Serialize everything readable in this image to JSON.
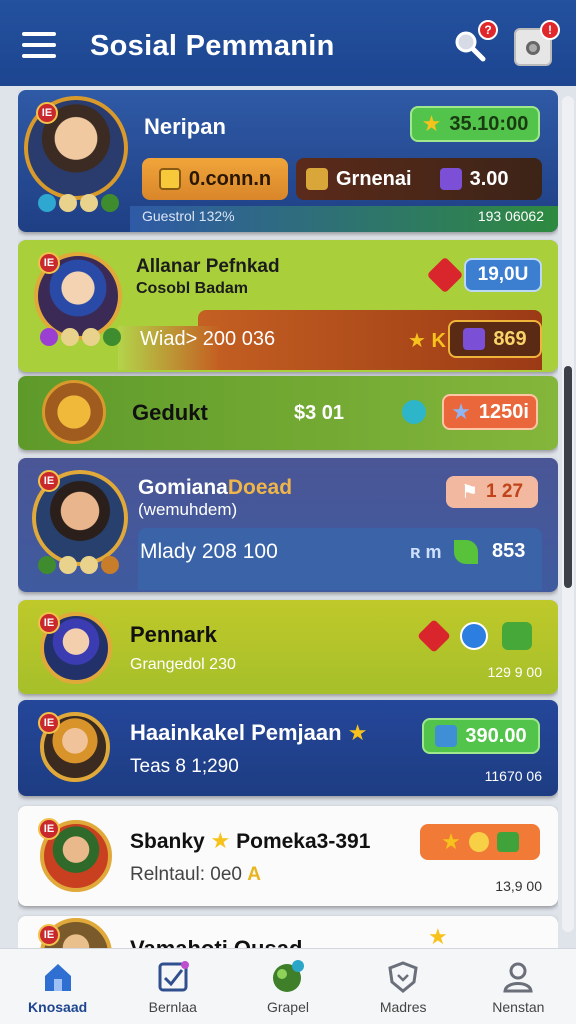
{
  "header": {
    "title": "Sosial Pemmanin",
    "search_badge": "?",
    "notif_badge": "!"
  },
  "cards": [
    {
      "name": "Neripan",
      "rank": "IE",
      "score": "35.10:00",
      "left_pill": "0.conn.n",
      "right_label": "Grnenai",
      "right_value": "3.00",
      "footer_left": "Guestrol 132%",
      "footer_right": "193 06062"
    },
    {
      "name": "Allanar Pefnkad",
      "subname": "Cosobl Badam",
      "rank": "IE",
      "badge_value": "19,0U",
      "bar_label": "Wiad> 200 036",
      "bar_icons": "★ K",
      "bar_value": "869"
    },
    {
      "name": "Gedukt",
      "value": "$3 01",
      "pill_value": "1250i"
    },
    {
      "name_part1": "Gomiana",
      "name_part2": "Doead",
      "subname": "(wemuhdem)",
      "rank": "IE",
      "badge_value": "1 27",
      "bar_label": "Mlady 208 100",
      "bar_icons": "ʀ m",
      "bar_value": "853"
    },
    {
      "name": "Pennark",
      "subname": "Grangedol 230",
      "rank": "IE",
      "footer_right": "129 9 00"
    },
    {
      "name": "Haainkakel Pemjaan",
      "subname": "Teas 8 1;290",
      "rank": "IE",
      "pill_value": "390.00",
      "footer_right": "11670 06"
    },
    {
      "name": "Sbanky",
      "name_suffix": "Pomeka3-391",
      "subname": "Relntaul: 0e0",
      "rank": "IE",
      "footer_right": "13,9 00"
    },
    {
      "name": "Vamahoti Ousad",
      "rank": "IE"
    }
  ],
  "nav": [
    {
      "label": "Knosaad",
      "icon": "home-icon"
    },
    {
      "label": "Bernlaa",
      "icon": "checklist-icon"
    },
    {
      "label": "Grapel",
      "icon": "globe-icon"
    },
    {
      "label": "Madres",
      "icon": "shield-icon"
    },
    {
      "label": "Nenstan",
      "icon": "person-icon"
    }
  ],
  "colors": {
    "header": "#1d4590",
    "card_navy": "#1f3f84",
    "card_lime": "#a9cf3b",
    "card_rust": "#b5481c",
    "card_green": "#6fa02e",
    "card_purple": "#4a5696",
    "card_olive": "#bfc92a",
    "card_white": "#ffffff"
  }
}
